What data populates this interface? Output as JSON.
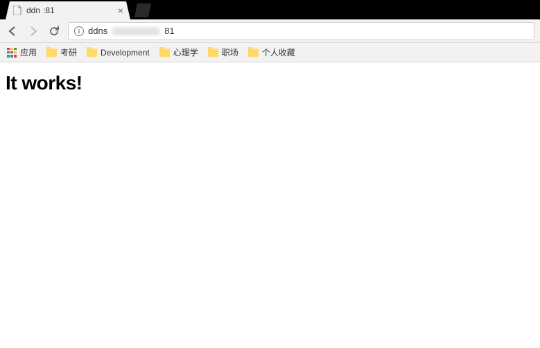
{
  "tab": {
    "title_prefix": "ddn",
    "title_suffix": ":81"
  },
  "url": {
    "prefix": "ddns",
    "suffix": "81"
  },
  "bookmarks": {
    "apps_label": "应用",
    "items": [
      "考研",
      "Development",
      "心理学",
      "职场",
      "个人收藏"
    ]
  },
  "page": {
    "heading": "It works!"
  }
}
